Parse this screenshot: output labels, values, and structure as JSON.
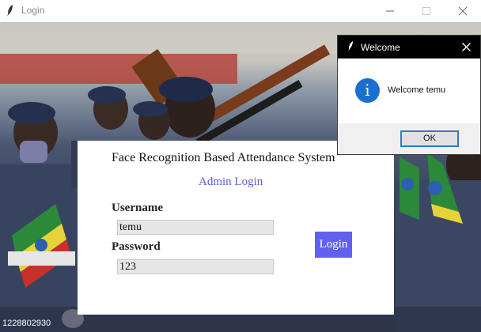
{
  "window": {
    "title": "Login",
    "icon": "feather-icon",
    "controls": [
      "minimize-icon",
      "maximize-icon",
      "close-icon"
    ]
  },
  "login": {
    "app_title": "Face Recognition Based Attendance System",
    "subtitle": "Admin Login",
    "username_label": "Username",
    "username_value": "temu",
    "password_label": "Password",
    "password_value": "123",
    "login_button": "Login"
  },
  "photo_caption": "1228802930",
  "dialog": {
    "title": "Welcome",
    "message": "Welcome temu",
    "ok_button": "OK",
    "icon": "info-icon"
  },
  "colors": {
    "accent": "#6161f0",
    "subtitle": "#5b5bd6",
    "dialog_focus": "#2e7ad1",
    "info_icon": "#1a6fd1"
  }
}
